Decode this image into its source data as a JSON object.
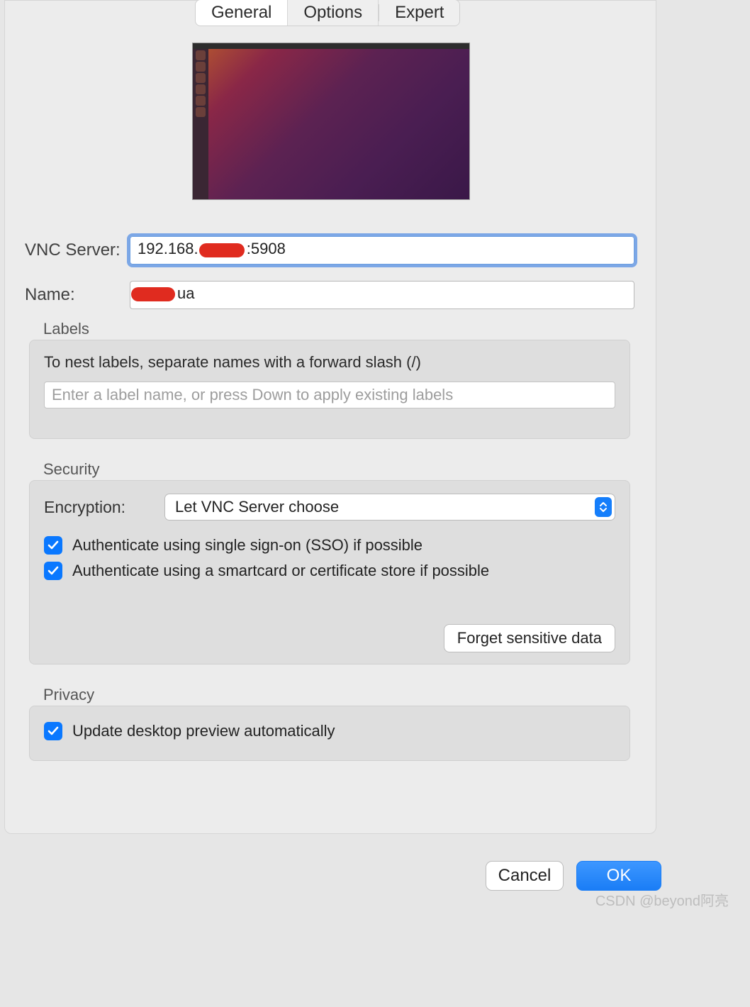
{
  "tabs": {
    "general": "General",
    "options": "Options",
    "expert": "Expert"
  },
  "fields": {
    "vnc_server_label": "VNC Server:",
    "vnc_server_prefix": "192.168.",
    "vnc_server_suffix": ":5908",
    "name_label": "Name:",
    "name_suffix": "ua"
  },
  "labels_section": {
    "title": "Labels",
    "help": "To nest labels, separate names with a forward slash (/)",
    "placeholder": "Enter a label name, or press Down to apply existing labels"
  },
  "security_section": {
    "title": "Security",
    "encryption_label": "Encryption:",
    "encryption_value": "Let VNC Server choose",
    "sso_label": "Authenticate using single sign-on (SSO) if possible",
    "smartcard_label": "Authenticate using a smartcard or certificate store if possible",
    "forget_button": "Forget sensitive data"
  },
  "privacy_section": {
    "title": "Privacy",
    "update_preview_label": "Update desktop preview automatically"
  },
  "buttons": {
    "cancel": "Cancel",
    "ok": "OK"
  },
  "watermark": "CSDN @beyond阿亮"
}
